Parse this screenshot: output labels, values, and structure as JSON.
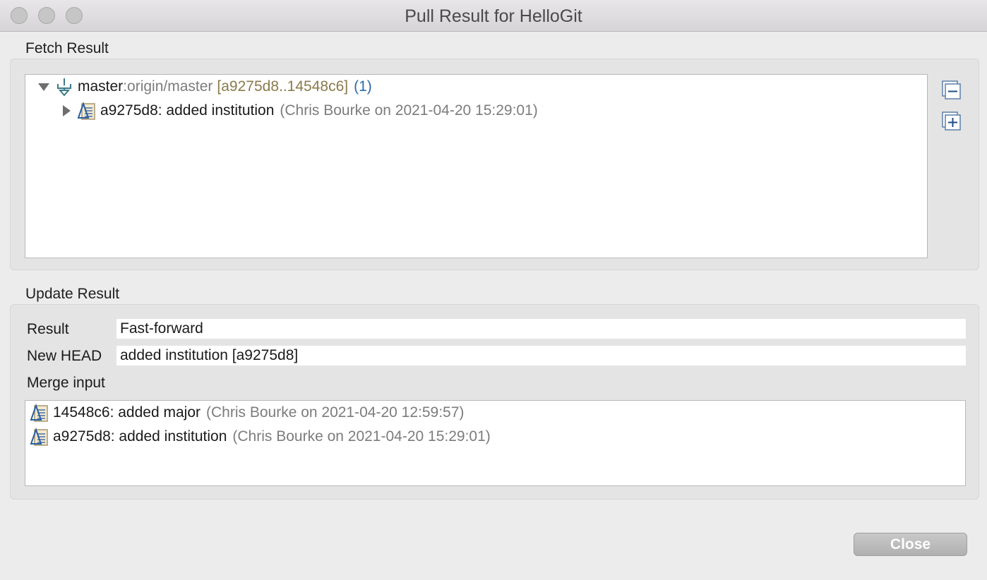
{
  "window": {
    "title": "Pull Result for HelloGit"
  },
  "fetch": {
    "label": "Fetch Result",
    "branch": {
      "name": "master",
      "sep": " : ",
      "remote": "origin/master",
      "range": "[a9275d8..14548c6]",
      "count": "(1)"
    },
    "commit": {
      "summary": "a9275d8: added institution",
      "meta": "(Chris Bourke on 2021-04-20 15:29:01)"
    }
  },
  "update": {
    "label": "Update Result",
    "result_label": "Result",
    "result_value": "Fast-forward",
    "head_label": "New HEAD",
    "head_value": "added institution [a9275d8]",
    "merge_label": "Merge input",
    "merge_items": [
      {
        "summary": "14548c6: added major",
        "meta": "(Chris Bourke on 2021-04-20 12:59:57)"
      },
      {
        "summary": "a9275d8: added institution",
        "meta": "(Chris Bourke on 2021-04-20 15:29:01)"
      }
    ]
  },
  "buttons": {
    "close": "Close"
  },
  "icons": {
    "expand_collapsed": "triangle-right-icon",
    "expand_open": "triangle-down-icon",
    "branch": "branch-icon",
    "commit": "commit-icon",
    "collapse_all": "collapse-all-icon",
    "expand_all": "expand-all-icon"
  },
  "colors": {
    "remote_range": "#8a7a4a",
    "count": "#2b6aa8",
    "meta": "#7c7c7c"
  }
}
